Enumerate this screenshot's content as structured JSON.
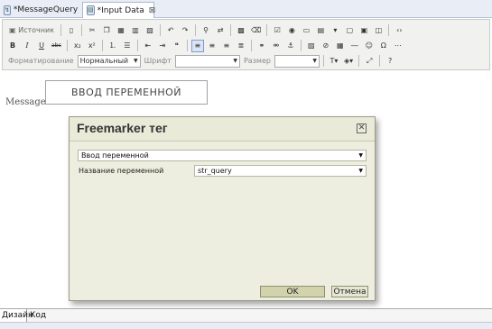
{
  "tabs": [
    {
      "label": "*MessageQuery"
    },
    {
      "label": "*Input Data"
    }
  ],
  "toolbar": {
    "source_label": "Источник",
    "format_label": "Форматирование",
    "format_value": "Нормальный",
    "font_label": "Шрифт",
    "font_value": "",
    "size_label": "Размер",
    "size_value": ""
  },
  "editor": {
    "message_label": "Message:",
    "variable_box_text": "ВВОД ПЕРЕМЕННОЙ"
  },
  "dialog": {
    "title": "Freemarker тег",
    "tag_select_value": "Ввод переменной",
    "variable_name_label": "Название переменной",
    "variable_name_value": "str_query",
    "ok_label": "OK",
    "cancel_label": "Отмена"
  },
  "bottom_tabs": [
    {
      "label": "Дизайн"
    },
    {
      "label": "Код"
    }
  ]
}
